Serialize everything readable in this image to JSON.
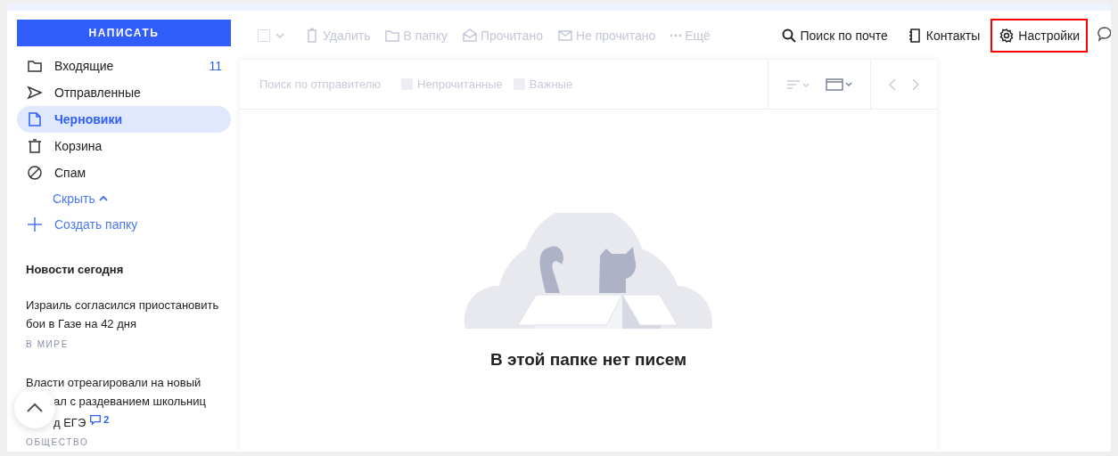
{
  "compose_button": "НАПИСАТЬ",
  "folders": [
    {
      "kind": "inbox",
      "label": "Входящие",
      "count": "11",
      "selected": false
    },
    {
      "kind": "sent",
      "label": "Отправленные",
      "selected": false
    },
    {
      "kind": "drafts",
      "label": "Черновики",
      "selected": true
    },
    {
      "kind": "trash",
      "label": "Корзина",
      "selected": false
    },
    {
      "kind": "spam",
      "label": "Спам",
      "selected": false
    }
  ],
  "hide_link": "Скрыть",
  "create_folder": "Создать папку",
  "news": {
    "title": "Новости сегодня",
    "items": [
      {
        "lines": [
          "Израиль согласился приостановить",
          "бои в Газе на 42 дня"
        ],
        "category": "В МИРЕ"
      },
      {
        "lines": [
          "Власти отреагировали на новый",
          "ал с раздеванием школьниц",
          "д ЕГЭ"
        ],
        "comments": "2",
        "category": "ОБЩЕСТВО"
      }
    ]
  },
  "toolbar": {
    "select_all": {
      "checked": false
    },
    "actions": [
      {
        "kind": "delete",
        "label": "Удалить"
      },
      {
        "kind": "folder",
        "label": "В папку"
      },
      {
        "kind": "read",
        "label": "Прочитано"
      },
      {
        "kind": "unread",
        "label": "Не прочитано"
      },
      {
        "kind": "more",
        "label": "Ещё"
      }
    ]
  },
  "top_links": [
    {
      "kind": "search",
      "label": "Поиск по почте",
      "highlighted": false
    },
    {
      "kind": "contacts",
      "label": "Контакты",
      "highlighted": false
    },
    {
      "kind": "settings",
      "label": "Настройки",
      "highlighted": true
    }
  ],
  "filter_bar": {
    "placeholder": "Поиск по отправителю",
    "filters": [
      {
        "label": "Непрочитанные",
        "checked": false
      },
      {
        "label": "Важные",
        "checked": false
      }
    ]
  },
  "empty_state": {
    "message": "В этой папке нет писем"
  }
}
